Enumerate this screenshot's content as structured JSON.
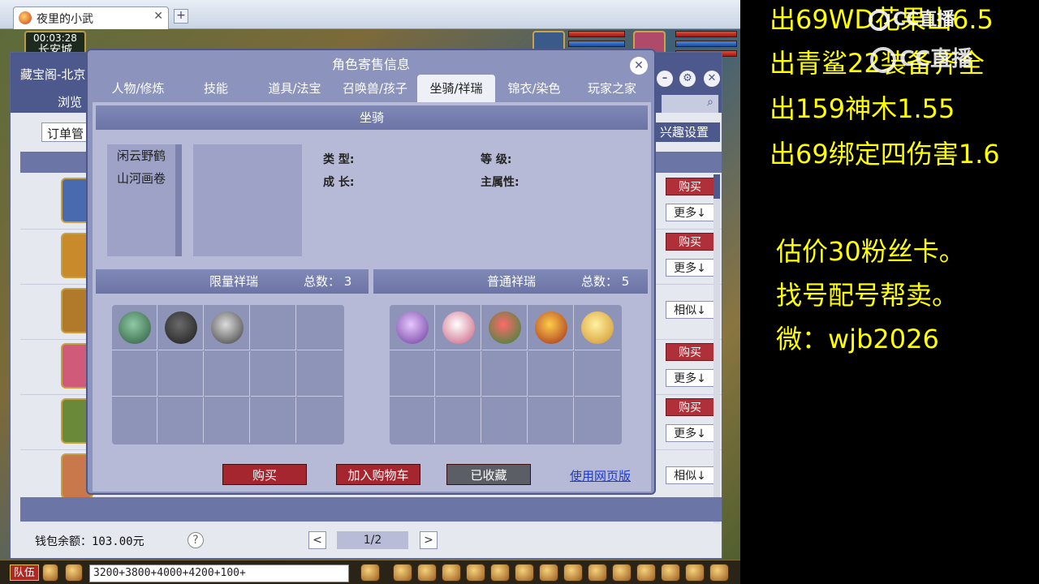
{
  "browser": {
    "tab_title": "夜里的小武",
    "close": "✕",
    "new_tab": "+"
  },
  "hud": {
    "time": "00:03:28",
    "city": "长安城"
  },
  "shop": {
    "title": "藏宝阁-北京",
    "browse": "浏览",
    "order_mgr": "订单管",
    "interest": "兴趣设置",
    "buy": "购买",
    "more": "更多↓",
    "similar": "相似↓",
    "wallet": "钱包余额：103.00元",
    "help": "?",
    "page": "1/2",
    "prev": "<",
    "next": ">"
  },
  "dialog": {
    "title": "角色寄售信息",
    "tabs": [
      "人物/修炼",
      "技能",
      "道具/法宝",
      "召唤兽/孩子",
      "坐骑/祥瑞",
      "锦衣/染色",
      "玩家之家"
    ],
    "active_tab": 4,
    "mount_section": "坐骑",
    "mounts": [
      "闲云野鹤",
      "山河画卷"
    ],
    "attrs": {
      "type": "类  型:",
      "growth": "成  长:",
      "level": "等  级:",
      "main_attr": "主属性:"
    },
    "limited": {
      "title": "限量祥瑞",
      "total": "总数： 3"
    },
    "normal": {
      "title": "普通祥瑞",
      "total": "总数： 5"
    },
    "buttons": {
      "buy": "购买",
      "add_cart": "加入购物车",
      "collected": "已收藏",
      "web": "使用网页版"
    }
  },
  "bottom": {
    "team": "队伍",
    "chat": "3200+3800+4000+4200+100+"
  },
  "overlay": {
    "lines": [
      "出69WD花果山6.5",
      "出青鲨22装备齐全",
      "出159神木1.55",
      "出69绑定四伤害1.6"
    ],
    "lines2": [
      "估价30粉丝卡。",
      "找号配号帮卖。",
      "微：wjb2026"
    ],
    "logo": "CC直播"
  },
  "colors": {
    "accent": "#4d588c",
    "buy_red": "#b0303a",
    "overlay_text": "#ffff00"
  }
}
